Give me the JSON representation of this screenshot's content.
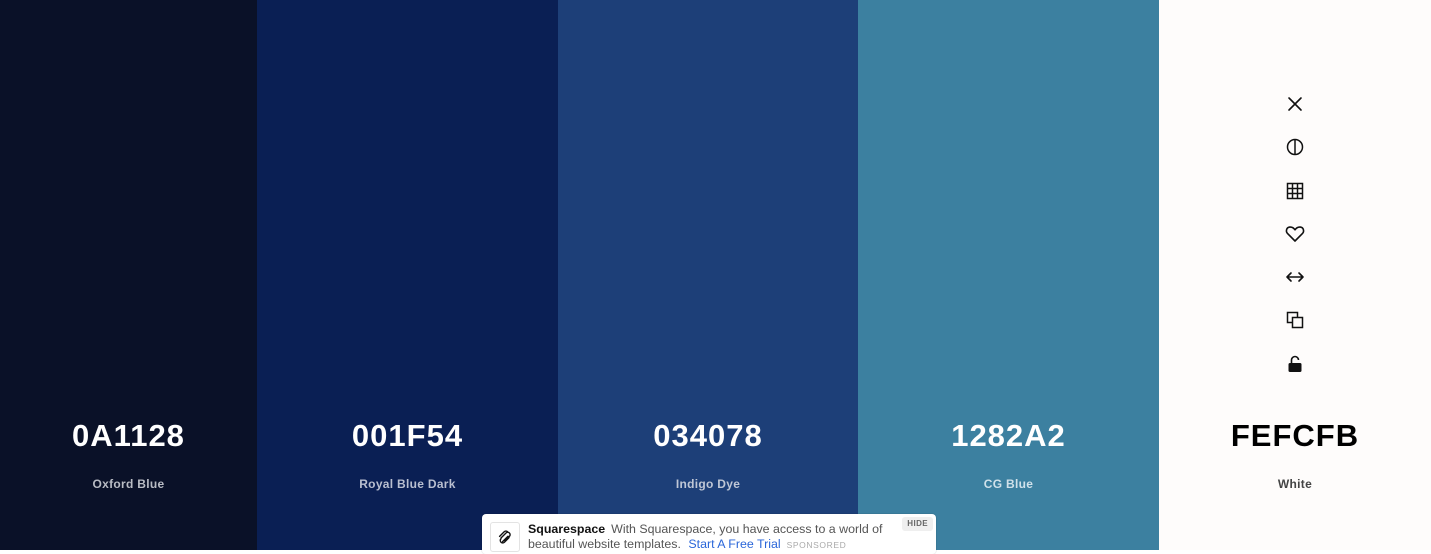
{
  "palette": [
    {
      "hex": "0A1128",
      "name": "Oxford Blue",
      "color": "#0A1128",
      "hex_color": "#ffffff",
      "name_color": "#b9bcc4"
    },
    {
      "hex": "001F54",
      "name": "Royal Blue Dark",
      "color": "#0A1F54",
      "hex_color": "#ffffff",
      "name_color": "#b9bfd0"
    },
    {
      "hex": "034078",
      "name": "Indigo Dye",
      "color": "#1D3F78",
      "hex_color": "#ffffff",
      "name_color": "#bfc7d6"
    },
    {
      "hex": "1282A2",
      "name": "CG Blue",
      "color": "#3C80A0",
      "hex_color": "#ffffff",
      "name_color": "#d0e1ea"
    },
    {
      "hex": "FEFCFB",
      "name": "White",
      "color": "#FEFCFB",
      "hex_color": "#000000",
      "name_color": "#444444"
    }
  ],
  "toolbar_icons": [
    "close-icon",
    "contrast-icon",
    "shades-grid-icon",
    "heart-icon",
    "drag-arrows-icon",
    "copy-icon",
    "unlock-icon"
  ],
  "ad": {
    "brand": "Squarespace",
    "text": "With Squarespace, you have access to a world of beautiful website templates.",
    "cta": "Start A Free Trial",
    "sponsored": "SPONSORED",
    "hide": "HIDE"
  }
}
